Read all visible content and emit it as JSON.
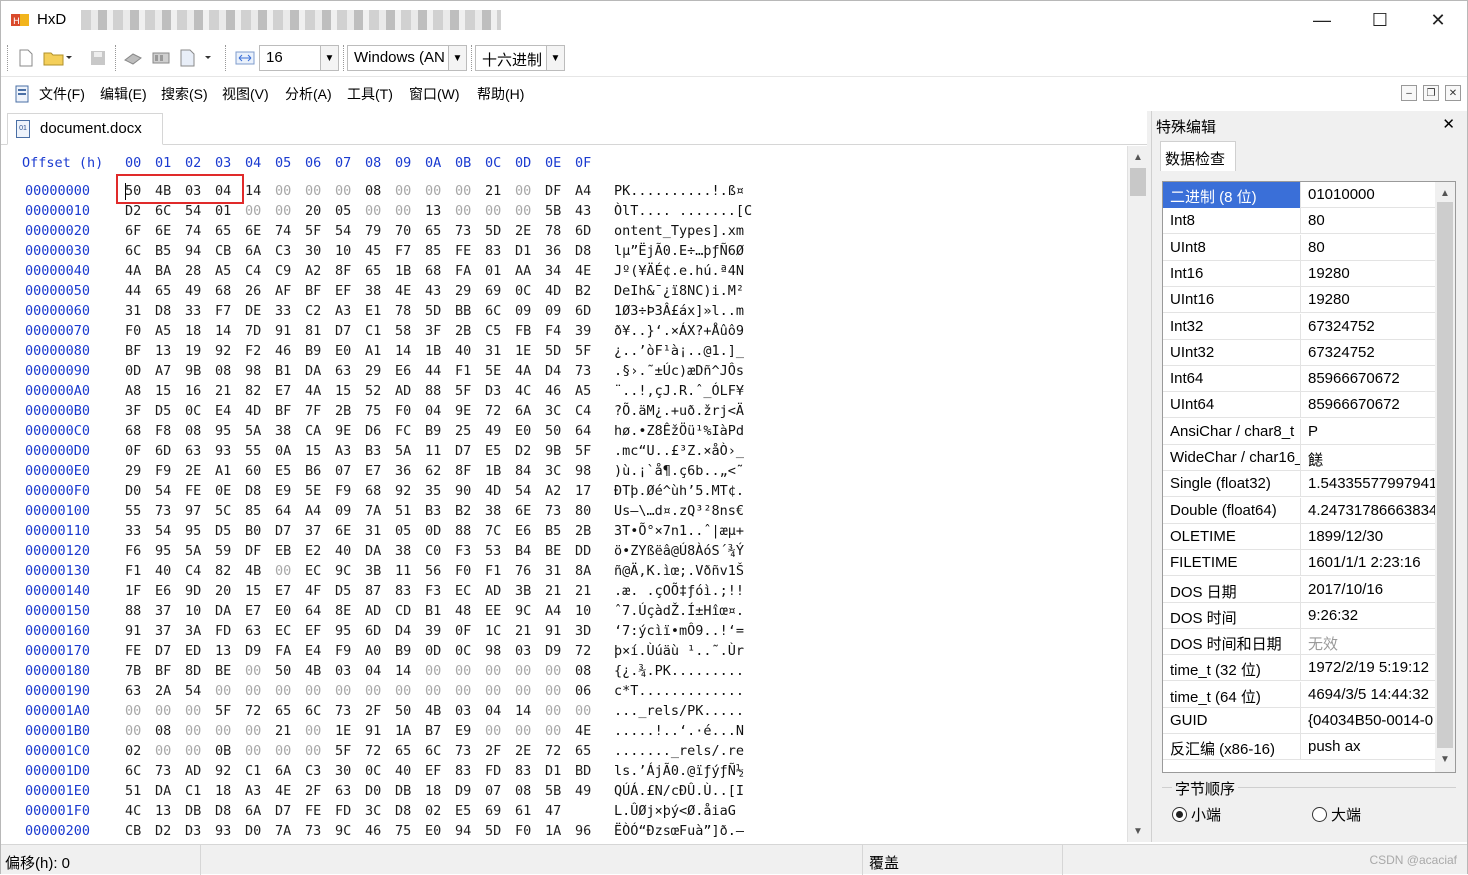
{
  "window": {
    "app_name": "HxD",
    "minimize": "—",
    "maximize": "☐",
    "close": "✕"
  },
  "toolbar": {
    "bytes_per_row": "16",
    "charset": "Windows (AN",
    "offset_base": "十六进制"
  },
  "menu": [
    "文件(F)",
    "编辑(E)",
    "搜索(S)",
    "视图(V)",
    "分析(A)",
    "工具(T)",
    "窗口(W)",
    "帮助(H)"
  ],
  "tab": {
    "filename": "document.docx"
  },
  "hex": {
    "header_label": "Offset (h)",
    "columns": [
      "00",
      "01",
      "02",
      "03",
      "04",
      "05",
      "06",
      "07",
      "08",
      "09",
      "0A",
      "0B",
      "0C",
      "0D",
      "0E",
      "0F"
    ],
    "rows": [
      {
        "offset": "00000000",
        "bytes": "50 4B 03 04 14 00 00 00 08 00 00 00 21 00 DF A4",
        "ascii": "PK..........!.ß¤"
      },
      {
        "offset": "00000010",
        "bytes": "D2 6C 54 01 00 00 20 05 00 00 13 00 00 00 5B 43",
        "ascii": "ÒlT.... .......[C"
      },
      {
        "offset": "00000020",
        "bytes": "6F 6E 74 65 6E 74 5F 54 79 70 65 73 5D 2E 78 6D",
        "ascii": "ontent_Types].xm"
      },
      {
        "offset": "00000030",
        "bytes": "6C B5 94 CB 6A C3 30 10 45 F7 85 FE 83 D1 36 D8",
        "ascii": "lµ”ËjÃ0.E÷…þƒÑ6Ø"
      },
      {
        "offset": "00000040",
        "bytes": "4A BA 28 A5 C4 C9 A2 8F 65 1B 68 FA 01 AA 34 4E",
        "ascii": "Jº(¥ÄÉ¢.e.hú.ª4N"
      },
      {
        "offset": "00000050",
        "bytes": "44 65 49 68 26 AF BF EF 38 4E 43 29 69 0C 4D B2",
        "ascii": "DeIh&¯¿ï8NC)i.M²"
      },
      {
        "offset": "00000060",
        "bytes": "31 D8 33 F7 DE 33 C2 A3 E1 78 5D BB 6C 09 09 6D",
        "ascii": "1Ø3÷Þ3Â£áx]»l..m"
      },
      {
        "offset": "00000070",
        "bytes": "F0 A5 18 14 7D 91 81 D7 C1 58 3F 2B C5 FB F4 39",
        "ascii": "ð¥..}‘.×ÁX?+Åûô9"
      },
      {
        "offset": "00000080",
        "bytes": "BF 13 19 92 F2 46 B9 E0 A1 14 1B 40 31 1E 5D 5F",
        "ascii": "¿..’òF¹à¡..@1.]_"
      },
      {
        "offset": "00000090",
        "bytes": "0D A7 9B 08 98 B1 DA 63 29 E6 44 F1 5E 4A D4 73",
        "ascii": ".§›.˜±Úc)æDñ^JÔs"
      },
      {
        "offset": "000000A0",
        "bytes": "A8 15 16 21 82 E7 4A 15 52 AD 88 5F D3 4C 46 A5",
        "ascii": "¨..!‚çJ.R.ˆ_ÓLF¥"
      },
      {
        "offset": "000000B0",
        "bytes": "3F D5 0C E4 4D BF 7F 2B 75 F0 04 9E 72 6A 3C C4",
        "ascii": "?Õ.äM¿.+uð.žrj<Ä"
      },
      {
        "offset": "000000C0",
        "bytes": "68 F8 08 95 5A 38 CA 9E D6 FC B9 25 49 E0 50 64",
        "ascii": "hø.•Z8ÊžÖü¹%IàPd"
      },
      {
        "offset": "000000D0",
        "bytes": "0F 6D 63 93 55 0A 15 A3 B3 5A 11 D7 E5 D2 9B 5F",
        "ascii": ".mc“U..£³Z.×åÒ›_"
      },
      {
        "offset": "000000E0",
        "bytes": "29 F9 2E A1 60 E5 B6 07 E7 36 62 8F 1B 84 3C 98",
        "ascii": ")ù.¡`å¶.ç6b..„<˜"
      },
      {
        "offset": "000000F0",
        "bytes": "D0 54 FE 0E D8 E9 5E F9 68 92 35 90 4D 54 A2 17",
        "ascii": "ÐTþ.Øé^ùh’5.MT¢."
      },
      {
        "offset": "00000100",
        "bytes": "55 73 97 5C 85 64 A4 09 7A 51 B3 B2 38 6E 73 80",
        "ascii": "Us—\\…d¤.zQ³²8ns€"
      },
      {
        "offset": "00000110",
        "bytes": "33 54 95 D5 B0 D7 37 6E 31 05 0D 88 7C E6 B5 2B",
        "ascii": "3T•Õ°×7n1..ˆ|æµ+"
      },
      {
        "offset": "00000120",
        "bytes": "F6 95 5A 59 DF EB E2 40 DA 38 C0 F3 53 B4 BE DD",
        "ascii": "ö•ZYßëâ@Ú8ÀóS´¾Ý"
      },
      {
        "offset": "00000130",
        "bytes": "F1 40 C4 82 4B 00 EC 9C 3B 11 56 F0 F1 76 31 8A",
        "ascii": "ñ@Ä‚K.ìœ;.Vðñv1Š"
      },
      {
        "offset": "00000140",
        "bytes": "1F E6 9D 20 15 E7 4F D5 87 83 F3 EC AD 3B 21 21",
        "ascii": ".æ. .çOÕ‡ƒóì.;!!"
      },
      {
        "offset": "00000150",
        "bytes": "88 37 10 DA E7 E0 64 8E AD CD B1 48 EE 9C A4 10",
        "ascii": "ˆ7.ÚçàdŽ.Í±Hîœ¤."
      },
      {
        "offset": "00000160",
        "bytes": "91 37 3A FD 63 EC EF 95 6D D4 39 0F 1C 21 91 3D",
        "ascii": "‘7:ýcìï•mÔ9..!‘="
      },
      {
        "offset": "00000170",
        "bytes": "FE D7 ED 13 D9 FA E4 F9 A0 B9 0D 0C 98 03 D9 72",
        "ascii": "þ×í.Ùúäù ¹..˜.Ùr"
      },
      {
        "offset": "00000180",
        "bytes": "7B BF 8D BE 00 50 4B 03 04 14 00 00 00 00 00 08",
        "ascii": "{¿.¾.PK........."
      },
      {
        "offset": "00000190",
        "bytes": "63 2A 54 00 00 00 00 00 00 00 00 00 00 00 00 06",
        "ascii": "c*T............."
      },
      {
        "offset": "000001A0",
        "bytes": "00 00 00 5F 72 65 6C 73 2F 50 4B 03 04 14 00 00",
        "ascii": "..._rels/PK....."
      },
      {
        "offset": "000001B0",
        "bytes": "00 08 00 00 00 21 00 1E 91 1A B7 E9 00 00 00 4E",
        "ascii": ".....!..‘.·é...N"
      },
      {
        "offset": "000001C0",
        "bytes": "02 00 00 0B 00 00 00 5F 72 65 6C 73 2F 2E 72 65",
        "ascii": "......._rels/.re"
      },
      {
        "offset": "000001D0",
        "bytes": "6C 73 AD 92 C1 6A C3 30 0C 40 EF 83 FD 83 D1 BD",
        "ascii": "ls.’ÁjÃ0.@ïƒýƒÑ½"
      },
      {
        "offset": "000001E0",
        "bytes": "51 DA C1 18 A3 4E 2F 63 D0 DB 18 D9 07 08 5B 49",
        "ascii": "QÚÁ.£N/cÐÛ.Ù..[I"
      },
      {
        "offset": "000001F0",
        "bytes": "4C 13 DB D8 6A D7 FE FD 3C D8 02 E5 69 61 47",
        "ascii": "L.ÛØj×þý<Ø.åiaG"
      },
      {
        "offset": "00000200",
        "bytes": "CB D2 D3 93 D0 7A 73 9C 46 75 E0 94 5D F0 1A 96",
        "ascii": "ËÒÓ“ÐzsœFuà”]ð.–"
      }
    ]
  },
  "special_edit": {
    "title": "特殊编辑",
    "tab": "数据检查",
    "rows": [
      {
        "name": "二进制 (8 位)",
        "value": "01010000"
      },
      {
        "name": "Int8",
        "value": "80"
      },
      {
        "name": "UInt8",
        "value": "80"
      },
      {
        "name": "Int16",
        "value": "19280"
      },
      {
        "name": "UInt16",
        "value": "19280"
      },
      {
        "name": "Int32",
        "value": "67324752"
      },
      {
        "name": "UInt32",
        "value": "67324752"
      },
      {
        "name": "Int64",
        "value": "85966670672"
      },
      {
        "name": "UInt64",
        "value": "85966670672"
      },
      {
        "name": "AnsiChar / char8_t",
        "value": "P"
      },
      {
        "name": "WideChar / char16_t",
        "value": "䭐"
      },
      {
        "name": "Single (float32)",
        "value": "1.54335577997941"
      },
      {
        "name": "Double (float64)",
        "value": "4.24731786663834"
      },
      {
        "name": "OLETIME",
        "value": "1899/12/30"
      },
      {
        "name": "FILETIME",
        "value": "1601/1/1 2:23:16"
      },
      {
        "name": "DOS 日期",
        "value": "2017/10/16"
      },
      {
        "name": "DOS 时间",
        "value": "9:26:32"
      },
      {
        "name": "DOS 时间和日期",
        "value": "无效"
      },
      {
        "name": "time_t (32 位)",
        "value": "1972/2/19 5:19:12"
      },
      {
        "name": "time_t (64 位)",
        "value": "4694/3/5 14:44:32"
      },
      {
        "name": "GUID",
        "value": "{04034B50-0014-0"
      },
      {
        "name": "反汇编 (x86-16)",
        "value": "push ax"
      }
    ],
    "byte_order_label": "字节顺序",
    "little_endian": "小端",
    "big_endian": "大端"
  },
  "status": {
    "offset": "偏移(h): 0",
    "mode": "覆盖",
    "watermark": "CSDN @acaciaf"
  }
}
